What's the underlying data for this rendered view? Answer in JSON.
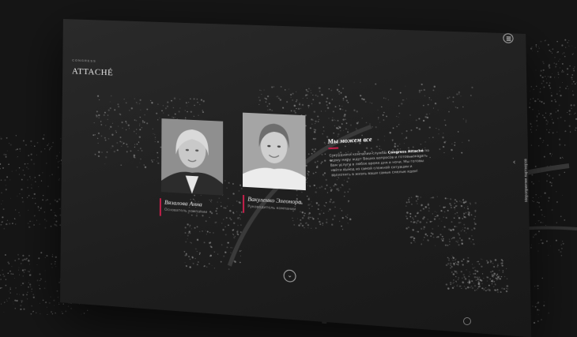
{
  "brand": {
    "small": "CONGRESS",
    "name": "ATTACHÉ"
  },
  "menu": {
    "icon": "hamburger-icon"
  },
  "side_nav": {
    "label": "Мероприятия партнеров",
    "arrow": "chevron-left-icon"
  },
  "team": [
    {
      "name": "Вязалова Анна",
      "role": "Основатель компании"
    },
    {
      "name": "Вакуленко Элеонора",
      "role": "Руководитель компании"
    }
  ],
  "about": {
    "title": "Мы можем все",
    "text_before": "Сотрудники компании-службы ",
    "brand_mention": "Congress Attaché",
    "text_after": " по всему миру ждут Ваших вопросов и готовы оказать Вам услуги в любое время дня и ночи. Мы готовы найти выход из самой сложной ситуации и воплотить в жизнь ваши самые смелые идеи!"
  },
  "scroll": {
    "icon": "chevron-down-icon",
    "glyph": "⌄"
  },
  "colors": {
    "accent": "#c0204a",
    "background": "#151515",
    "panel": "#222222"
  }
}
